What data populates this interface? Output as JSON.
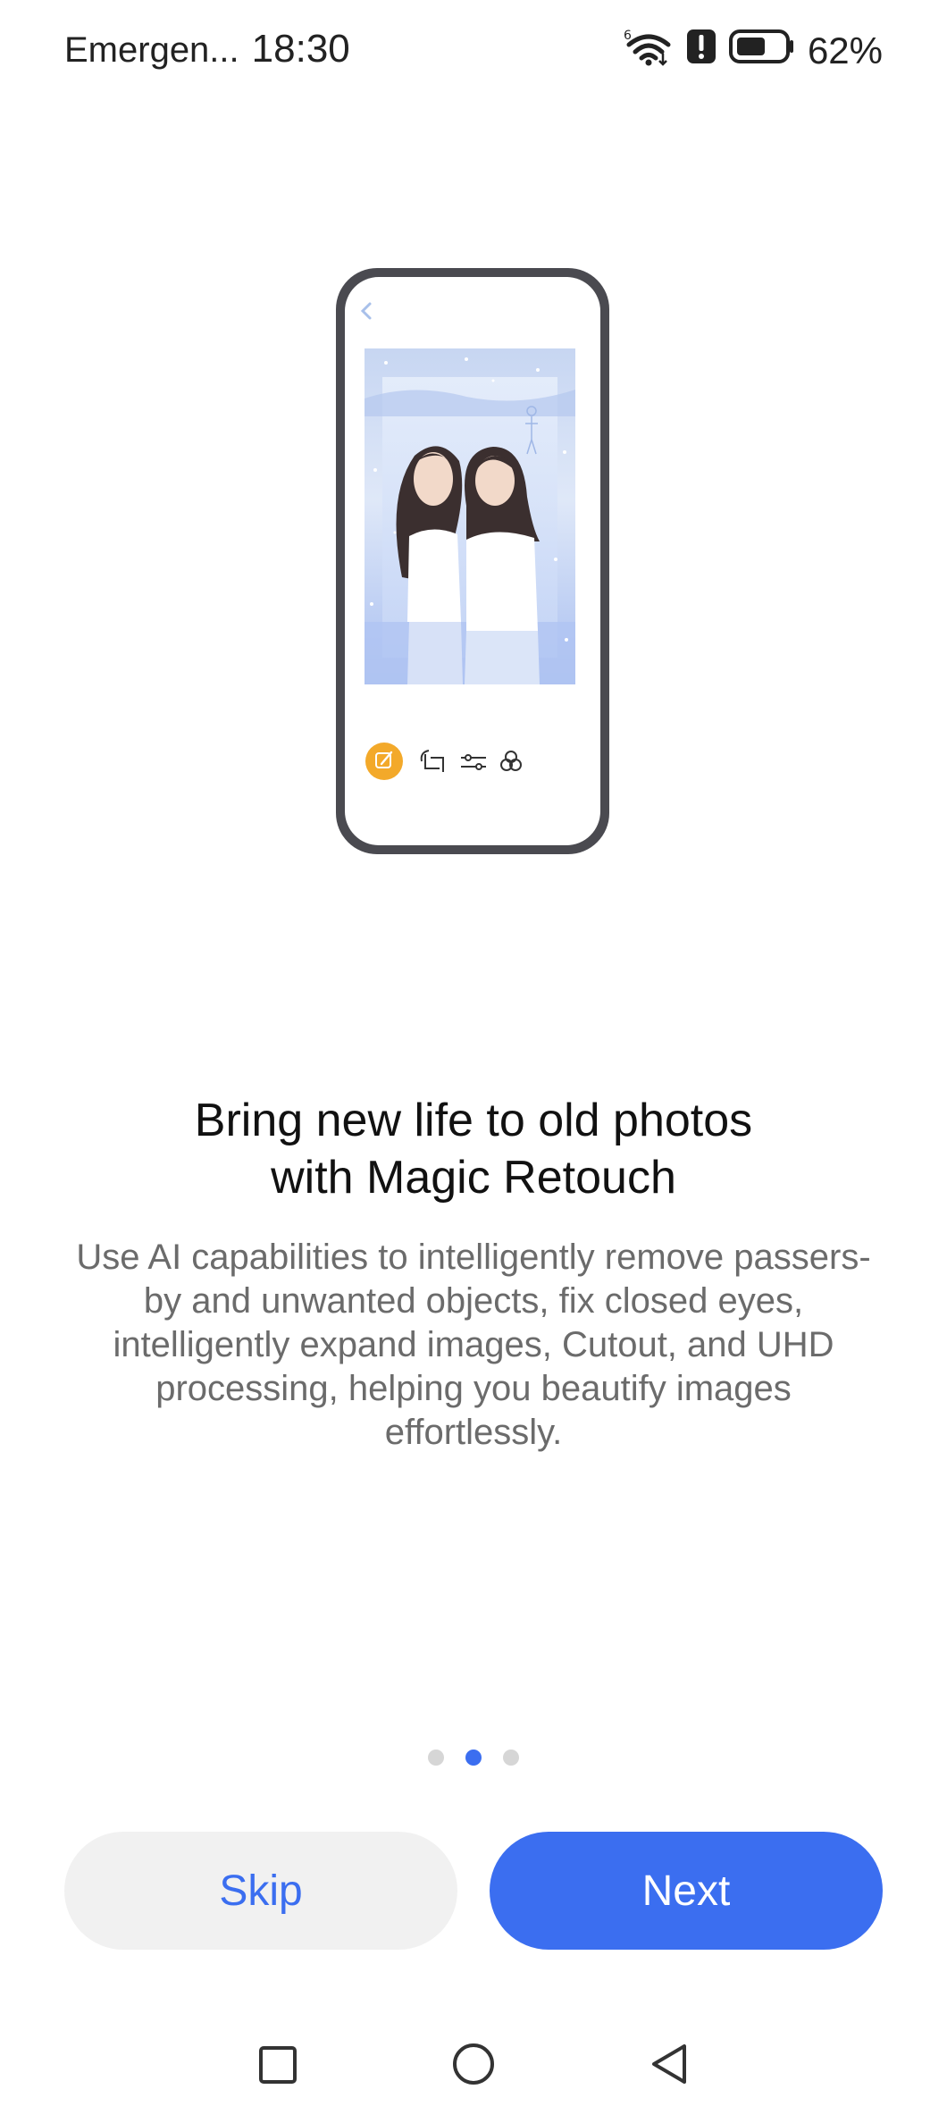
{
  "status_bar": {
    "carrier": "Emergen...",
    "time": "18:30",
    "battery_percent": "62%",
    "battery_level": 0.62,
    "icons": [
      "wifi-6-icon",
      "alert-icon",
      "battery-icon"
    ]
  },
  "onboarding": {
    "headline_line1": "Bring new life to old photos",
    "headline_line2": "with Magic Retouch",
    "description": "Use AI capabilities to intelligently remove passers-by and unwanted objects, fix closed eyes, intelligently expand images, Cutout, and UHD processing, helping you beautify images effortlessly.",
    "page_index": 2,
    "page_count": 3
  },
  "buttons": {
    "skip": "Skip",
    "next": "Next"
  },
  "illustration": {
    "icons": [
      "back-chevron-icon",
      "magic-edit-icon",
      "crop-icon",
      "adjust-icon",
      "filters-icon"
    ],
    "accent": "#f3a92a"
  },
  "colors": {
    "accent": "#3b6ef0",
    "skip_bg": "#f1f1f1"
  },
  "nav_bar": {
    "icons": [
      "recents-square-icon",
      "home-circle-icon",
      "back-triangle-icon"
    ]
  }
}
